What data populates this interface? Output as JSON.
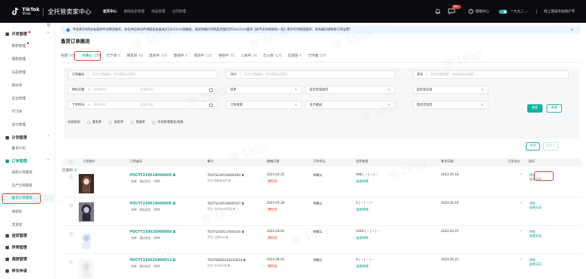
{
  "topbar": {
    "logo_main": "TikTok",
    "logo_sub": "Shop",
    "system_title": "全托管卖家中心",
    "nav": [
      "首页中心",
      "基础信息管理",
      "商品管理",
      "合同管理"
    ],
    "badge": "99+",
    "help": "帮助中心",
    "user": "一九九二",
    "shop": "线上测试中店商户号",
    "colors": {
      "background": "#0b0b0f",
      "accent": "#1fb5a9",
      "badge": "#e6392b"
    }
  },
  "sidebar": {
    "collapse_icon": "collapse-icon",
    "groups": [
      {
        "label": "开发管理",
        "chevron": "^"
      },
      {
        "label": "计划管理",
        "chevron": "^"
      },
      {
        "label": "订单管理",
        "chevron": "^"
      },
      {
        "label": "送货管理"
      },
      {
        "label": "异常管理"
      },
      {
        "label": "调拨管理"
      },
      {
        "label": "样衣申请"
      }
    ],
    "dev_items": [
      "新款管理",
      "报款管理",
      "议品管理",
      "核价库",
      "企业管理",
      "尺寸库",
      "设计管理"
    ],
    "plan_items": [
      "备货计划"
    ],
    "order_items": [
      "采购订单跟进",
      "生产订单跟进",
      "备货订单跟进",
      "待核权",
      "发货单"
    ]
  },
  "notice": {
    "text": "平台将于8月左右提供平台物流服务，各位供应商伙伴请提前准备采买10x15cm热敏纸，调试热敏打印机是否能打印10x15cm面单【如不支持领采购一份】用于打印物流面单，如有疑问请联系订单运营！",
    "close": "×"
  },
  "page_title": "备货订单跟进",
  "status_tabs": [
    {
      "label": "全部",
      "count": "900"
    },
    {
      "label": "待确认",
      "count": "179"
    },
    {
      "label": "已下单",
      "count": "5"
    },
    {
      "label": "待发货",
      "count": "92"
    },
    {
      "label": "送货中",
      "count": "105"
    },
    {
      "label": "签收中",
      "count": "0"
    },
    {
      "label": "收货中",
      "count": "131"
    },
    {
      "label": "待检中",
      "count": "35"
    },
    {
      "label": "入库中",
      "count": "24"
    },
    {
      "label": "已入库",
      "count": "126"
    },
    {
      "label": "已驳回",
      "count": "4"
    },
    {
      "label": "已作废",
      "count": "205"
    }
  ],
  "filters": {
    "order_no": {
      "label": "订单编号",
      "placeholder": "支持全量搜索、中间用逗号隔开"
    },
    "spu": {
      "label": "SPU",
      "placeholder": "支持全量搜索、中间用逗号隔开"
    },
    "item_no": {
      "label": "货号",
      "placeholder": "支持全量搜索、中间用逗号隔开"
    },
    "date1": {
      "label": "目标交期",
      "start": "开始时间",
      "end": "结束时间"
    },
    "sel_first": {
      "label": "首单"
    },
    "sel_done": {
      "label": "是否完成发货"
    },
    "sel_abnormal": {
      "label": "是否有异常"
    },
    "date2": {
      "label": "下单时间",
      "start": "开始时间",
      "end": "结束时间"
    },
    "sel_source": {
      "label": "订单来源"
    },
    "sel_mode": {
      "label": "生产模式"
    },
    "sel_return": {
      "label": "是否可退货"
    },
    "search_button": "搜索",
    "reset_button": "重置",
    "quick": {
      "label": "快捷搜索:",
      "options": [
        "紧急单",
        "加急单",
        "普通单",
        "今日新增紧急/加急"
      ]
    }
  },
  "toolbar": {
    "selected_prefix": "已选中:",
    "selected_count": "0",
    "export": "导出",
    "print": "打印"
  },
  "table": {
    "headers": [
      "订单图片",
      "订单编号",
      "SPU",
      "目标交期",
      "订单状态",
      "订单数量",
      "下单日期",
      "订单总价",
      "操作"
    ],
    "rows": [
      {
        "order_no": "POCYT230518000005",
        "tags": [
          "首单",
          "建议发货",
          "OBM"
        ],
        "spu": "TESTS230518000065",
        "item_no": "货号:热敏测试号",
        "target_date": "2023.05.25",
        "late": "超时1天",
        "status": "待确认",
        "qty": "998 | -- | -- | --",
        "qty_link": "查看明细",
        "order_date": "2023.05.18",
        "total": "--",
        "action1": "审核",
        "action2": "查看日志"
      },
      {
        "order_no": "POCYT230519000006",
        "tags": [
          "首单",
          "建议发货",
          "OBM"
        ],
        "spu": "TESTS230518000107",
        "item_no": "货号: hshtest0518",
        "target_date": "2023.05.26",
        "late": "超时1天",
        "status": "待确认",
        "qty": "5 | -- | -- | --",
        "qty_link": "查看明细",
        "order_date": "2023.05.19",
        "total": "--",
        "action1": "审核",
        "action2": "查看日志"
      },
      {
        "order_no": "POCYT230525000009",
        "tags": [
          "首单",
          "建议发货",
          "OBM"
        ],
        "spu": "TESTS230517000145",
        "item_no": "货号: 这是sku",
        "target_date": "2023.06.01",
        "late": "超时1天",
        "status": "待确认",
        "qty": "1003 | -- | -- | --",
        "qty_link": "查看明细",
        "order_date": "2023.05.25",
        "total": "--",
        "action1": "审核",
        "action2": "查看日志"
      },
      {
        "order_no": "POCYT230525000013",
        "tags": [
          "首单",
          "建议发货",
          "OBM"
        ],
        "spu": "TESTSWDS230210010",
        "item_no": "货号: test0210",
        "target_date": "2023.06.01",
        "late": "超时1天",
        "status": "待确认",
        "qty": "6 | -- | -- | --",
        "qty_link": "查看明细",
        "order_date": "2023.05.25",
        "total": "--",
        "action1": "审核",
        "action2": "查看日志"
      }
    ]
  },
  "watermark": "徐 1850"
}
